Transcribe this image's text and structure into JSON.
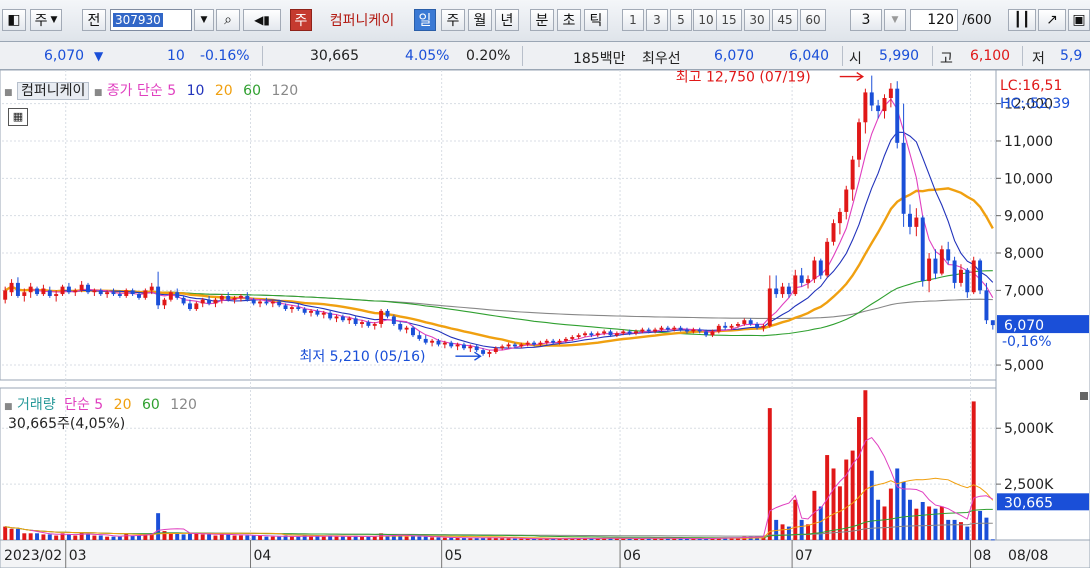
{
  "toolbar": {
    "type_label": "주",
    "prev_label": "전",
    "code": "307930",
    "stock_name": "컴퍼니케이",
    "name_badge": "주",
    "periods": [
      "일",
      "주",
      "월",
      "년",
      "분",
      "초",
      "틱"
    ],
    "intervals": [
      "1",
      "3",
      "5",
      "10",
      "15",
      "30",
      "45",
      "60"
    ],
    "custom_interval": "3",
    "count": "120",
    "count_total": "/600"
  },
  "quote": {
    "price": "6,070",
    "change_arrow": "▼",
    "change": "10",
    "change_pct": "-0.16%",
    "volume": "30,665",
    "vol_ratio": "4.05%",
    "turnover": "0.20%",
    "amount": "185백만",
    "bid_label": "최우선",
    "ask": "6,070",
    "bid": "6,040",
    "open_label": "시",
    "open": "5,990",
    "high_label": "고",
    "high": "6,100",
    "low_label": "저",
    "low": "5,9"
  },
  "price_legend": {
    "name": "컴퍼니케이",
    "ma_label": "종가 단순",
    "periods": [
      "5",
      "10",
      "20",
      "60",
      "120"
    ]
  },
  "volume_legend": {
    "title": "거래량",
    "ma_label": "단순",
    "periods": [
      "5",
      "20",
      "60",
      "120"
    ],
    "current": "30,665주(4,05%)"
  },
  "right_axis": {
    "lc": "LC:16,51",
    "hc": "HC:-52,39",
    "price_ticks": [
      "12,000",
      "11,000",
      "10,000",
      "9,000",
      "8,000",
      "7,000",
      "5,000"
    ],
    "current_price": "6,070",
    "current_pct": "-0,16%",
    "volume_ticks": [
      "5,000K",
      "2,500K"
    ],
    "current_volume": "30,665",
    "current_vol_pct": "4,05%"
  },
  "annotations": {
    "high": "최고 12,750 (07/19)",
    "low": "최저 5,210 (05/16)"
  },
  "x_labels": [
    "2023/02",
    "03",
    "04",
    "05",
    "06",
    "07",
    "08",
    "08/08"
  ],
  "colors": {
    "up": "#e01818",
    "down": "#1a4fd8",
    "ma5": "#e040c0",
    "ma10": "#2233bb",
    "ma20": "#f0a010",
    "ma60": "#30a030",
    "ma120": "#888888"
  },
  "chart_data": {
    "type": "candlestick",
    "period": "daily",
    "ylim": [
      4600,
      12900
    ],
    "volume_ylim": [
      0,
      6800000
    ],
    "candles": [
      [
        6750,
        7100,
        6650,
        7000,
        600000
      ],
      [
        6950,
        7300,
        6850,
        7200,
        500000
      ],
      [
        7200,
        7350,
        6800,
        6850,
        500000
      ],
      [
        6850,
        7050,
        6700,
        6950,
        300000
      ],
      [
        6950,
        7200,
        6800,
        7100,
        300000
      ],
      [
        7050,
        7100,
        6850,
        6900,
        300000
      ],
      [
        6900,
        7150,
        6850,
        7050,
        250000
      ],
      [
        7000,
        7100,
        6800,
        6850,
        250000
      ],
      [
        6850,
        7000,
        6700,
        6900,
        200000
      ],
      [
        6900,
        7150,
        6850,
        7100,
        300000
      ],
      [
        7100,
        7200,
        6900,
        6950,
        250000
      ],
      [
        6950,
        7050,
        6850,
        7000,
        200000
      ],
      [
        7000,
        7250,
        6950,
        7150,
        350000
      ],
      [
        7150,
        7200,
        6900,
        6950,
        250000
      ],
      [
        6950,
        7050,
        6850,
        7000,
        200000
      ],
      [
        7000,
        7050,
        6850,
        6900,
        200000
      ],
      [
        6900,
        7000,
        6800,
        6950,
        150000
      ],
      [
        6950,
        7050,
        6850,
        6900,
        150000
      ],
      [
        6900,
        7000,
        6800,
        6850,
        150000
      ],
      [
        6850,
        7050,
        6800,
        7000,
        300000
      ],
      [
        7000,
        7050,
        6850,
        6900,
        200000
      ],
      [
        6900,
        6950,
        6750,
        6800,
        200000
      ],
      [
        6800,
        7050,
        6750,
        7000,
        250000
      ],
      [
        7000,
        7200,
        6900,
        7100,
        300000
      ],
      [
        7100,
        7500,
        6500,
        6600,
        1200000
      ],
      [
        6600,
        6800,
        6500,
        6750,
        400000
      ],
      [
        6750,
        7000,
        6700,
        6950,
        300000
      ],
      [
        6950,
        7050,
        6750,
        6800,
        300000
      ],
      [
        6800,
        6850,
        6600,
        6650,
        250000
      ],
      [
        6650,
        6750,
        6450,
        6500,
        300000
      ],
      [
        6500,
        6700,
        6450,
        6650,
        300000
      ],
      [
        6650,
        6800,
        6550,
        6750,
        250000
      ],
      [
        6750,
        6850,
        6600,
        6650,
        250000
      ],
      [
        6650,
        6800,
        6550,
        6750,
        200000
      ],
      [
        6750,
        6900,
        6650,
        6850,
        300000
      ],
      [
        6850,
        6950,
        6700,
        6750,
        250000
      ],
      [
        6750,
        6850,
        6650,
        6800,
        200000
      ],
      [
        6800,
        6900,
        6700,
        6850,
        200000
      ],
      [
        6850,
        6950,
        6700,
        6750,
        200000
      ],
      [
        6750,
        6800,
        6600,
        6650,
        200000
      ],
      [
        6650,
        6750,
        6550,
        6700,
        200000
      ],
      [
        6700,
        6800,
        6600,
        6650,
        150000
      ],
      [
        6650,
        6750,
        6550,
        6700,
        150000
      ],
      [
        6700,
        6750,
        6550,
        6600,
        150000
      ],
      [
        6600,
        6650,
        6450,
        6500,
        200000
      ],
      [
        6500,
        6600,
        6400,
        6550,
        150000
      ],
      [
        6550,
        6650,
        6450,
        6500,
        150000
      ],
      [
        6500,
        6550,
        6350,
        6400,
        200000
      ],
      [
        6400,
        6500,
        6300,
        6450,
        150000
      ],
      [
        6450,
        6500,
        6300,
        6350,
        200000
      ],
      [
        6350,
        6450,
        6250,
        6400,
        150000
      ],
      [
        6400,
        6450,
        6200,
        6250,
        200000
      ],
      [
        6250,
        6350,
        6150,
        6300,
        150000
      ],
      [
        6300,
        6350,
        6150,
        6200,
        150000
      ],
      [
        6200,
        6300,
        6100,
        6250,
        150000
      ],
      [
        6250,
        6300,
        6050,
        6100,
        200000
      ],
      [
        6100,
        6200,
        6000,
        6150,
        150000
      ],
      [
        6150,
        6200,
        6000,
        6050,
        150000
      ],
      [
        6050,
        6150,
        5950,
        6100,
        150000
      ],
      [
        6100,
        6500,
        6000,
        6450,
        300000
      ],
      [
        6450,
        6500,
        6250,
        6300,
        200000
      ],
      [
        6300,
        6350,
        6050,
        6100,
        200000
      ],
      [
        6100,
        6150,
        5900,
        5950,
        200000
      ],
      [
        5950,
        6050,
        5850,
        6000,
        150000
      ],
      [
        6000,
        6050,
        5750,
        5800,
        200000
      ],
      [
        5800,
        5900,
        5650,
        5700,
        150000
      ],
      [
        5700,
        5800,
        5550,
        5600,
        150000
      ],
      [
        5600,
        5700,
        5500,
        5650,
        120000
      ],
      [
        5650,
        5700,
        5500,
        5550,
        120000
      ],
      [
        5550,
        5650,
        5450,
        5600,
        100000
      ],
      [
        5600,
        5650,
        5450,
        5500,
        100000
      ],
      [
        5500,
        5600,
        5400,
        5550,
        100000
      ],
      [
        5550,
        5600,
        5400,
        5450,
        100000
      ],
      [
        5450,
        5550,
        5350,
        5500,
        80000
      ],
      [
        5500,
        5550,
        5350,
        5400,
        80000
      ],
      [
        5400,
        5450,
        5250,
        5300,
        100000
      ],
      [
        5300,
        5400,
        5210,
        5350,
        120000
      ],
      [
        5350,
        5500,
        5300,
        5450,
        100000
      ],
      [
        5450,
        5550,
        5400,
        5500,
        80000
      ],
      [
        5500,
        5600,
        5450,
        5550,
        70000
      ],
      [
        5550,
        5600,
        5450,
        5500,
        60000
      ],
      [
        5500,
        5600,
        5450,
        5550,
        60000
      ],
      [
        5550,
        5650,
        5500,
        5600,
        60000
      ],
      [
        5600,
        5650,
        5500,
        5550,
        60000
      ],
      [
        5550,
        5650,
        5500,
        5600,
        60000
      ],
      [
        5600,
        5700,
        5550,
        5650,
        60000
      ],
      [
        5650,
        5700,
        5550,
        5600,
        60000
      ],
      [
        5600,
        5700,
        5550,
        5650,
        60000
      ],
      [
        5650,
        5750,
        5600,
        5700,
        70000
      ],
      [
        5700,
        5800,
        5650,
        5750,
        70000
      ],
      [
        5750,
        5850,
        5700,
        5800,
        70000
      ],
      [
        5800,
        5900,
        5750,
        5850,
        80000
      ],
      [
        5850,
        5900,
        5750,
        5800,
        70000
      ],
      [
        5800,
        5900,
        5750,
        5850,
        70000
      ],
      [
        5850,
        5950,
        5800,
        5900,
        80000
      ],
      [
        5900,
        5950,
        5750,
        5800,
        80000
      ],
      [
        5800,
        5900,
        5750,
        5850,
        70000
      ],
      [
        5850,
        5950,
        5800,
        5900,
        70000
      ],
      [
        5900,
        5950,
        5800,
        5850,
        70000
      ],
      [
        5850,
        5950,
        5800,
        5900,
        70000
      ],
      [
        5900,
        6000,
        5850,
        5950,
        80000
      ],
      [
        5950,
        6000,
        5850,
        5900,
        80000
      ],
      [
        5900,
        6000,
        5850,
        5950,
        70000
      ],
      [
        5950,
        6050,
        5900,
        6000,
        80000
      ],
      [
        6000,
        6050,
        5900,
        5950,
        70000
      ],
      [
        5950,
        6050,
        5900,
        6000,
        70000
      ],
      [
        6000,
        6050,
        5900,
        5950,
        60000
      ],
      [
        5950,
        6000,
        5850,
        5900,
        60000
      ],
      [
        5900,
        6000,
        5850,
        5950,
        60000
      ],
      [
        5950,
        6000,
        5850,
        5900,
        60000
      ],
      [
        5900,
        5950,
        5750,
        5800,
        80000
      ],
      [
        5800,
        5950,
        5750,
        5900,
        80000
      ],
      [
        5900,
        6100,
        5850,
        6050,
        100000
      ],
      [
        6050,
        6150,
        5950,
        6000,
        100000
      ],
      [
        6000,
        6100,
        5950,
        6050,
        100000
      ],
      [
        6050,
        6150,
        6000,
        6100,
        100000
      ],
      [
        6100,
        6250,
        6050,
        6200,
        150000
      ],
      [
        6200,
        6250,
        6050,
        6100,
        150000
      ],
      [
        6100,
        6150,
        5950,
        6000,
        150000
      ],
      [
        6000,
        6100,
        5900,
        6050,
        150000
      ],
      [
        6050,
        7400,
        6000,
        7050,
        5900000
      ],
      [
        7050,
        7400,
        6800,
        6900,
        900000
      ],
      [
        6900,
        7200,
        6800,
        7100,
        700000
      ],
      [
        7100,
        7200,
        6800,
        6900,
        600000
      ],
      [
        6900,
        7550,
        6850,
        7400,
        1800000
      ],
      [
        7400,
        7600,
        7100,
        7200,
        900000
      ],
      [
        7200,
        7400,
        7050,
        7300,
        700000
      ],
      [
        7300,
        7900,
        7200,
        7800,
        2200000
      ],
      [
        7800,
        7850,
        7300,
        7400,
        1500000
      ],
      [
        7400,
        8400,
        7350,
        8300,
        3800000
      ],
      [
        8300,
        8900,
        8200,
        8800,
        3200000
      ],
      [
        8800,
        9200,
        8500,
        9100,
        2400000
      ],
      [
        9100,
        9800,
        8900,
        9700,
        3600000
      ],
      [
        9700,
        10600,
        9400,
        10500,
        4000000
      ],
      [
        10500,
        11600,
        10300,
        11500,
        5500000
      ],
      [
        11500,
        12400,
        11200,
        12300,
        6700000
      ],
      [
        12300,
        12750,
        11800,
        11950,
        3100000
      ],
      [
        11950,
        12100,
        11600,
        11800,
        1800000
      ],
      [
        11800,
        12250,
        11600,
        12150,
        1500000
      ],
      [
        12150,
        12550,
        11900,
        12400,
        2300000
      ],
      [
        12400,
        12600,
        10800,
        10950,
        3200000
      ],
      [
        10950,
        12000,
        8700,
        9050,
        2600000
      ],
      [
        9050,
        9300,
        8500,
        8700,
        1800000
      ],
      [
        8700,
        9200,
        8450,
        8950,
        1400000
      ],
      [
        8950,
        9000,
        7100,
        7250,
        1700000
      ],
      [
        7250,
        8000,
        6950,
        7850,
        1500000
      ],
      [
        7850,
        8100,
        7300,
        7450,
        1400000
      ],
      [
        7450,
        8200,
        7400,
        8100,
        1500000
      ],
      [
        8100,
        8300,
        7700,
        7800,
        900000
      ],
      [
        7800,
        7900,
        7050,
        7200,
        900000
      ],
      [
        7200,
        7700,
        7100,
        7550,
        800000
      ],
      [
        7550,
        7600,
        6800,
        6950,
        600000
      ],
      [
        6950,
        7900,
        6900,
        7800,
        6200000
      ],
      [
        7800,
        7850,
        6900,
        7000,
        1300000
      ],
      [
        7000,
        7200,
        6100,
        6200,
        1000000
      ],
      [
        6200,
        6200,
        5950,
        6070,
        30665
      ]
    ],
    "label_indices": {
      "03": 10,
      "04": 39,
      "05": 69,
      "06": 97,
      "07": 124,
      "08": 152
    }
  }
}
